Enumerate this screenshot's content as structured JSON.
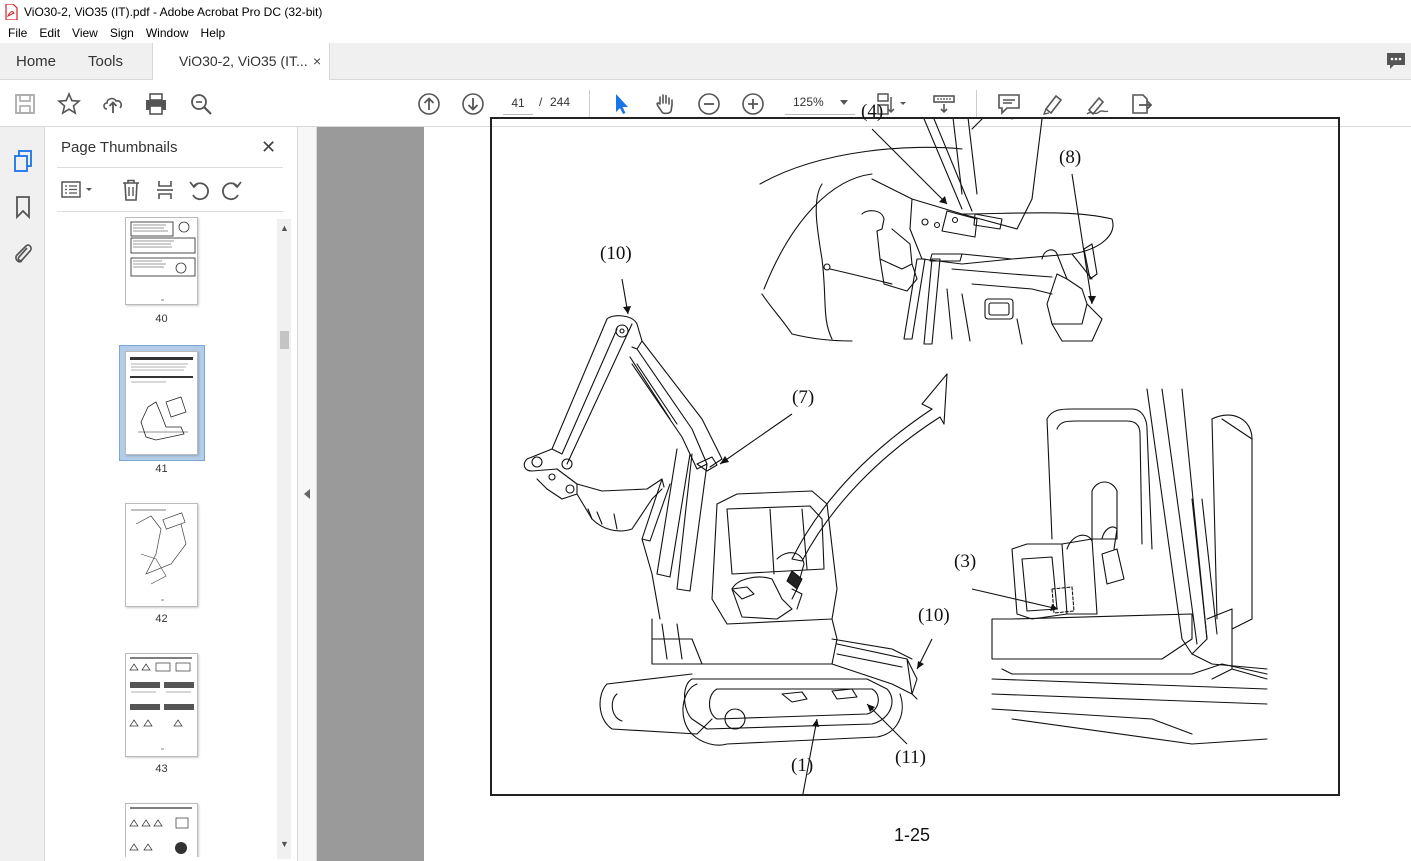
{
  "window": {
    "title": "ViO30-2, ViO35 (IT).pdf - Adobe Acrobat Pro DC (32-bit)"
  },
  "menu": [
    "File",
    "Edit",
    "View",
    "Sign",
    "Window",
    "Help"
  ],
  "tabs": {
    "home": "Home",
    "tools": "Tools",
    "document": "ViO30-2, ViO35 (IT...",
    "close": "×"
  },
  "toolbar": {
    "page_current": "41",
    "page_separator": "/",
    "page_total": "244",
    "zoom": "125%",
    "icons": [
      "save-icon",
      "star-icon",
      "upload-icon",
      "print-icon",
      "zoom-search-icon",
      "page-up-icon",
      "page-down-icon",
      "select-cursor-icon",
      "hand-icon",
      "zoom-out-icon",
      "zoom-in-icon",
      "page-layout-icon",
      "scan-icon",
      "comment-icon",
      "highlight-icon",
      "sign-icon",
      "export-icon"
    ]
  },
  "left_rail": {
    "icons": [
      "page-thumbnails-icon",
      "bookmark-icon",
      "attachment-icon"
    ]
  },
  "thumbnails_panel": {
    "title": "Page Thumbnails",
    "close": "✕",
    "pages": [
      {
        "number": "40",
        "selected": false
      },
      {
        "number": "41",
        "selected": true
      },
      {
        "number": "42",
        "selected": false
      },
      {
        "number": "43",
        "selected": false
      }
    ]
  },
  "document": {
    "callouts": {
      "c4": "(4)",
      "c8": "(8)",
      "c10a": "(10)",
      "c7": "(7)",
      "c3": "(3)",
      "c10b": "(10)",
      "c1": "(1)",
      "c11": "(11)"
    },
    "page_label": "1-25"
  },
  "colors": {
    "pdf_red": "#d2232a",
    "selection_blue": "#b3cde8",
    "canvas_gray": "#9a9a9a",
    "accent_blue": "#1a73e8"
  }
}
